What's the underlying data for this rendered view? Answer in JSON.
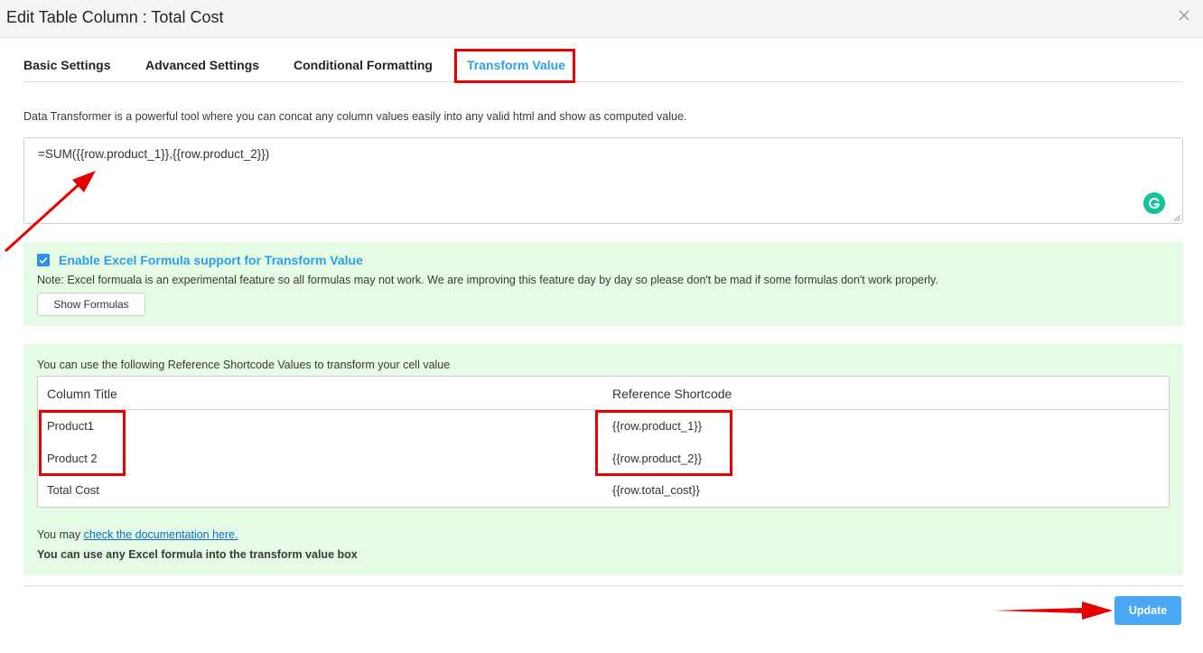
{
  "dialog": {
    "title": "Edit Table Column : Total Cost"
  },
  "tabs": [
    {
      "label": "Basic Settings"
    },
    {
      "label": "Advanced Settings"
    },
    {
      "label": "Conditional Formatting"
    },
    {
      "label": "Transform Value"
    }
  ],
  "active_tab": "Transform Value",
  "description": "Data Transformer is a powerful tool where you can concat any column values easily into any valid html and show as computed value.",
  "formula_value": "=SUM({{row.product_1}},{{row.product_2}})",
  "excel_support": {
    "checked": true,
    "label": "Enable Excel Formula support for Transform Value",
    "note": "Note: Excel formuala is an experimental feature so all formulas may not work. We are improving this feature day by day so please don't be mad if some formulas don't work properly.",
    "show_button": "Show Formulas"
  },
  "reference": {
    "intro": "You can use the following Reference Shortcode Values to transform your cell value",
    "columns": [
      "Column Title",
      "Reference Shortcode"
    ],
    "rows": [
      [
        "Product1",
        "{{row.product_1}}"
      ],
      [
        "Product 2",
        "{{row.product_2}}"
      ],
      [
        "Total Cost",
        "{{row.total_cost}}"
      ]
    ],
    "doc_prefix": "You may ",
    "doc_link": "check the documentation here.",
    "bold_note": "You can use any Excel formula into the transform value box"
  },
  "footer": {
    "update_label": "Update"
  },
  "colors": {
    "accent": "#2d9fe6",
    "highlight": "#e60000",
    "panel_bg": "#e5fbe5",
    "update_bg": "#4aa8f5"
  }
}
